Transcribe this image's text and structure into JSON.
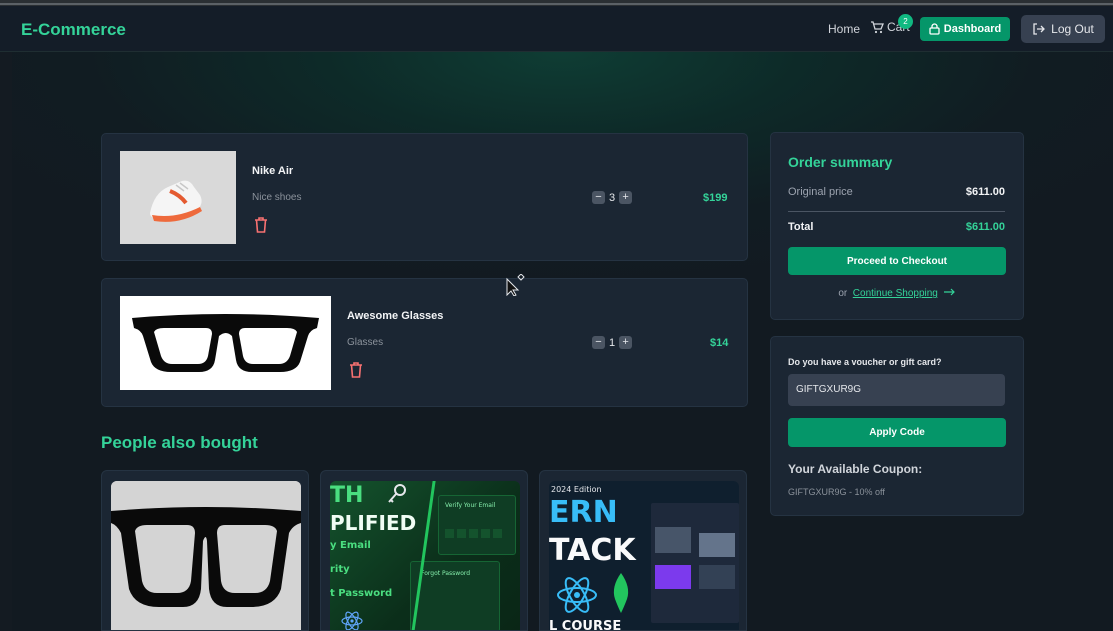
{
  "nav": {
    "brand": "E-Commerce",
    "home": "Home",
    "cart": "Cart",
    "cart_count": "2",
    "dashboard": "Dashboard",
    "logout": "Log Out"
  },
  "cart_items": [
    {
      "name": "Nike Air",
      "description": "Nice shoes",
      "quantity": "3",
      "price": "$199"
    },
    {
      "name": "Awesome Glasses",
      "description": "Glasses",
      "quantity": "1",
      "price": "$14"
    }
  ],
  "order_summary": {
    "title": "Order summary",
    "original_price_label": "Original price",
    "original_price": "$611.00",
    "total_label": "Total",
    "total": "$611.00",
    "checkout_button": "Proceed to Checkout",
    "or": "or",
    "continue_shopping": "Continue Shopping"
  },
  "voucher": {
    "question": "Do you have a voucher or gift card?",
    "input_value": "GIFTGXUR9G",
    "apply_button": "Apply Code",
    "available_title": "Your Available Coupon:",
    "available_coupon": "GIFTGXUR9G - 10% off"
  },
  "recommendations": {
    "title": "People also bought",
    "card2": {
      "big1": "TH",
      "big2": "PLIFIED",
      "l1": "y Email",
      "l2": "rity",
      "l3": "t Password",
      "panel1": "Verify Your Email",
      "panel2": "Forgot Password"
    },
    "card3": {
      "edition": "2024 Edition",
      "big1": "ERN",
      "big2": "TACK",
      "bottom": "L COURSE"
    }
  },
  "colors": {
    "accent": "#34d399",
    "button": "#059669",
    "card": "#1b2633",
    "danger": "#f87171"
  }
}
